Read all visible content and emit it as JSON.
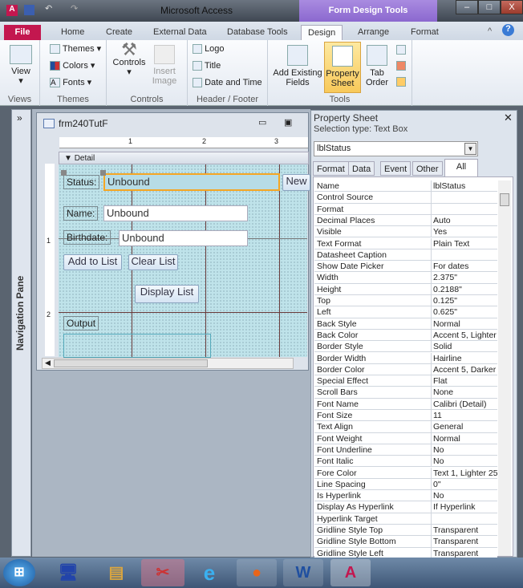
{
  "titlebar": {
    "app_title": "Microsoft Access",
    "context_tab": "Form Design Tools",
    "minimize": "–",
    "maximize": "□",
    "close": "X"
  },
  "tabs": {
    "file": "File",
    "home": "Home",
    "create": "Create",
    "external": "External Data",
    "dbtools": "Database Tools",
    "design": "Design",
    "arrange": "Arrange",
    "format": "Format"
  },
  "ribbon": {
    "views": {
      "view": "View",
      "label": "Views"
    },
    "themes": {
      "themes": "Themes",
      "colors": "Colors",
      "fonts": "Fonts",
      "label": "Themes"
    },
    "controls": {
      "controls": "Controls",
      "insert_image": "Insert Image",
      "label": "Controls"
    },
    "header": {
      "logo": "Logo",
      "title": "Title",
      "datetime": "Date and Time",
      "label": "Header / Footer"
    },
    "tools": {
      "add_fields": "Add Existing Fields",
      "property_sheet": "Property Sheet",
      "tab_order": "Tab Order",
      "label": "Tools"
    }
  },
  "nav_pane": {
    "label": "Navigation Pane",
    "toggle": "»"
  },
  "form": {
    "title": "frm240TutF",
    "section": "Detail",
    "ruler": [
      "1",
      "2",
      "3"
    ],
    "vruler": [
      "1",
      "2"
    ],
    "status_label": "Status:",
    "status_value": "Unbound",
    "new_button": "New",
    "name_label": "Name:",
    "name_value": "Unbound",
    "birth_label": "Birthdate:",
    "birth_value": "Unbound",
    "add_button": "Add to List",
    "clear_button": "Clear List",
    "display_button": "Display List",
    "output_label": "Output"
  },
  "property_sheet": {
    "title": "Property Sheet",
    "selection_type": "Selection type:  Text Box",
    "selected": "lblStatus",
    "tabs": [
      "Format",
      "Data",
      "Event",
      "Other",
      "All"
    ],
    "active_tab": "All",
    "rows": [
      {
        "name": "Name",
        "value": "lblStatus"
      },
      {
        "name": "Control Source",
        "value": ""
      },
      {
        "name": "Format",
        "value": ""
      },
      {
        "name": "Decimal Places",
        "value": "Auto"
      },
      {
        "name": "Visible",
        "value": "Yes"
      },
      {
        "name": "Text Format",
        "value": "Plain Text"
      },
      {
        "name": "Datasheet Caption",
        "value": ""
      },
      {
        "name": "Show Date Picker",
        "value": "For dates"
      },
      {
        "name": "Width",
        "value": "2.375\""
      },
      {
        "name": "Height",
        "value": "0.2188\""
      },
      {
        "name": "Top",
        "value": "0.125\""
      },
      {
        "name": "Left",
        "value": "0.625\""
      },
      {
        "name": "Back Style",
        "value": "Normal"
      },
      {
        "name": "Back Color",
        "value": "Accent 5, Lighter"
      },
      {
        "name": "Border Style",
        "value": "Solid"
      },
      {
        "name": "Border Width",
        "value": "Hairline"
      },
      {
        "name": "Border Color",
        "value": "Accent 5, Darker"
      },
      {
        "name": "Special Effect",
        "value": "Flat"
      },
      {
        "name": "Scroll Bars",
        "value": "None"
      },
      {
        "name": "Font Name",
        "value": "Calibri (Detail)"
      },
      {
        "name": "Font Size",
        "value": "11"
      },
      {
        "name": "Text Align",
        "value": "General"
      },
      {
        "name": "Font Weight",
        "value": "Normal"
      },
      {
        "name": "Font Underline",
        "value": "No"
      },
      {
        "name": "Font Italic",
        "value": "No"
      },
      {
        "name": "Fore Color",
        "value": "Text 1, Lighter 25"
      },
      {
        "name": "Line Spacing",
        "value": "0\""
      },
      {
        "name": "Is Hyperlink",
        "value": "No"
      },
      {
        "name": "Display As Hyperlink",
        "value": "If Hyperlink"
      },
      {
        "name": "Hyperlink Target",
        "value": ""
      },
      {
        "name": "Gridline Style Top",
        "value": "Transparent"
      },
      {
        "name": "Gridline Style Bottom",
        "value": "Transparent"
      },
      {
        "name": "Gridline Style Left",
        "value": "Transparent"
      }
    ]
  },
  "taskbar": {
    "apps": [
      "start",
      "remote-desktop",
      "explorer",
      "snipping-tool",
      "internet-explorer",
      "firefox",
      "word",
      "access"
    ]
  },
  "colors": {
    "accent": "#c3174f",
    "context": "#8b68cf",
    "selection": "#f5a623"
  }
}
